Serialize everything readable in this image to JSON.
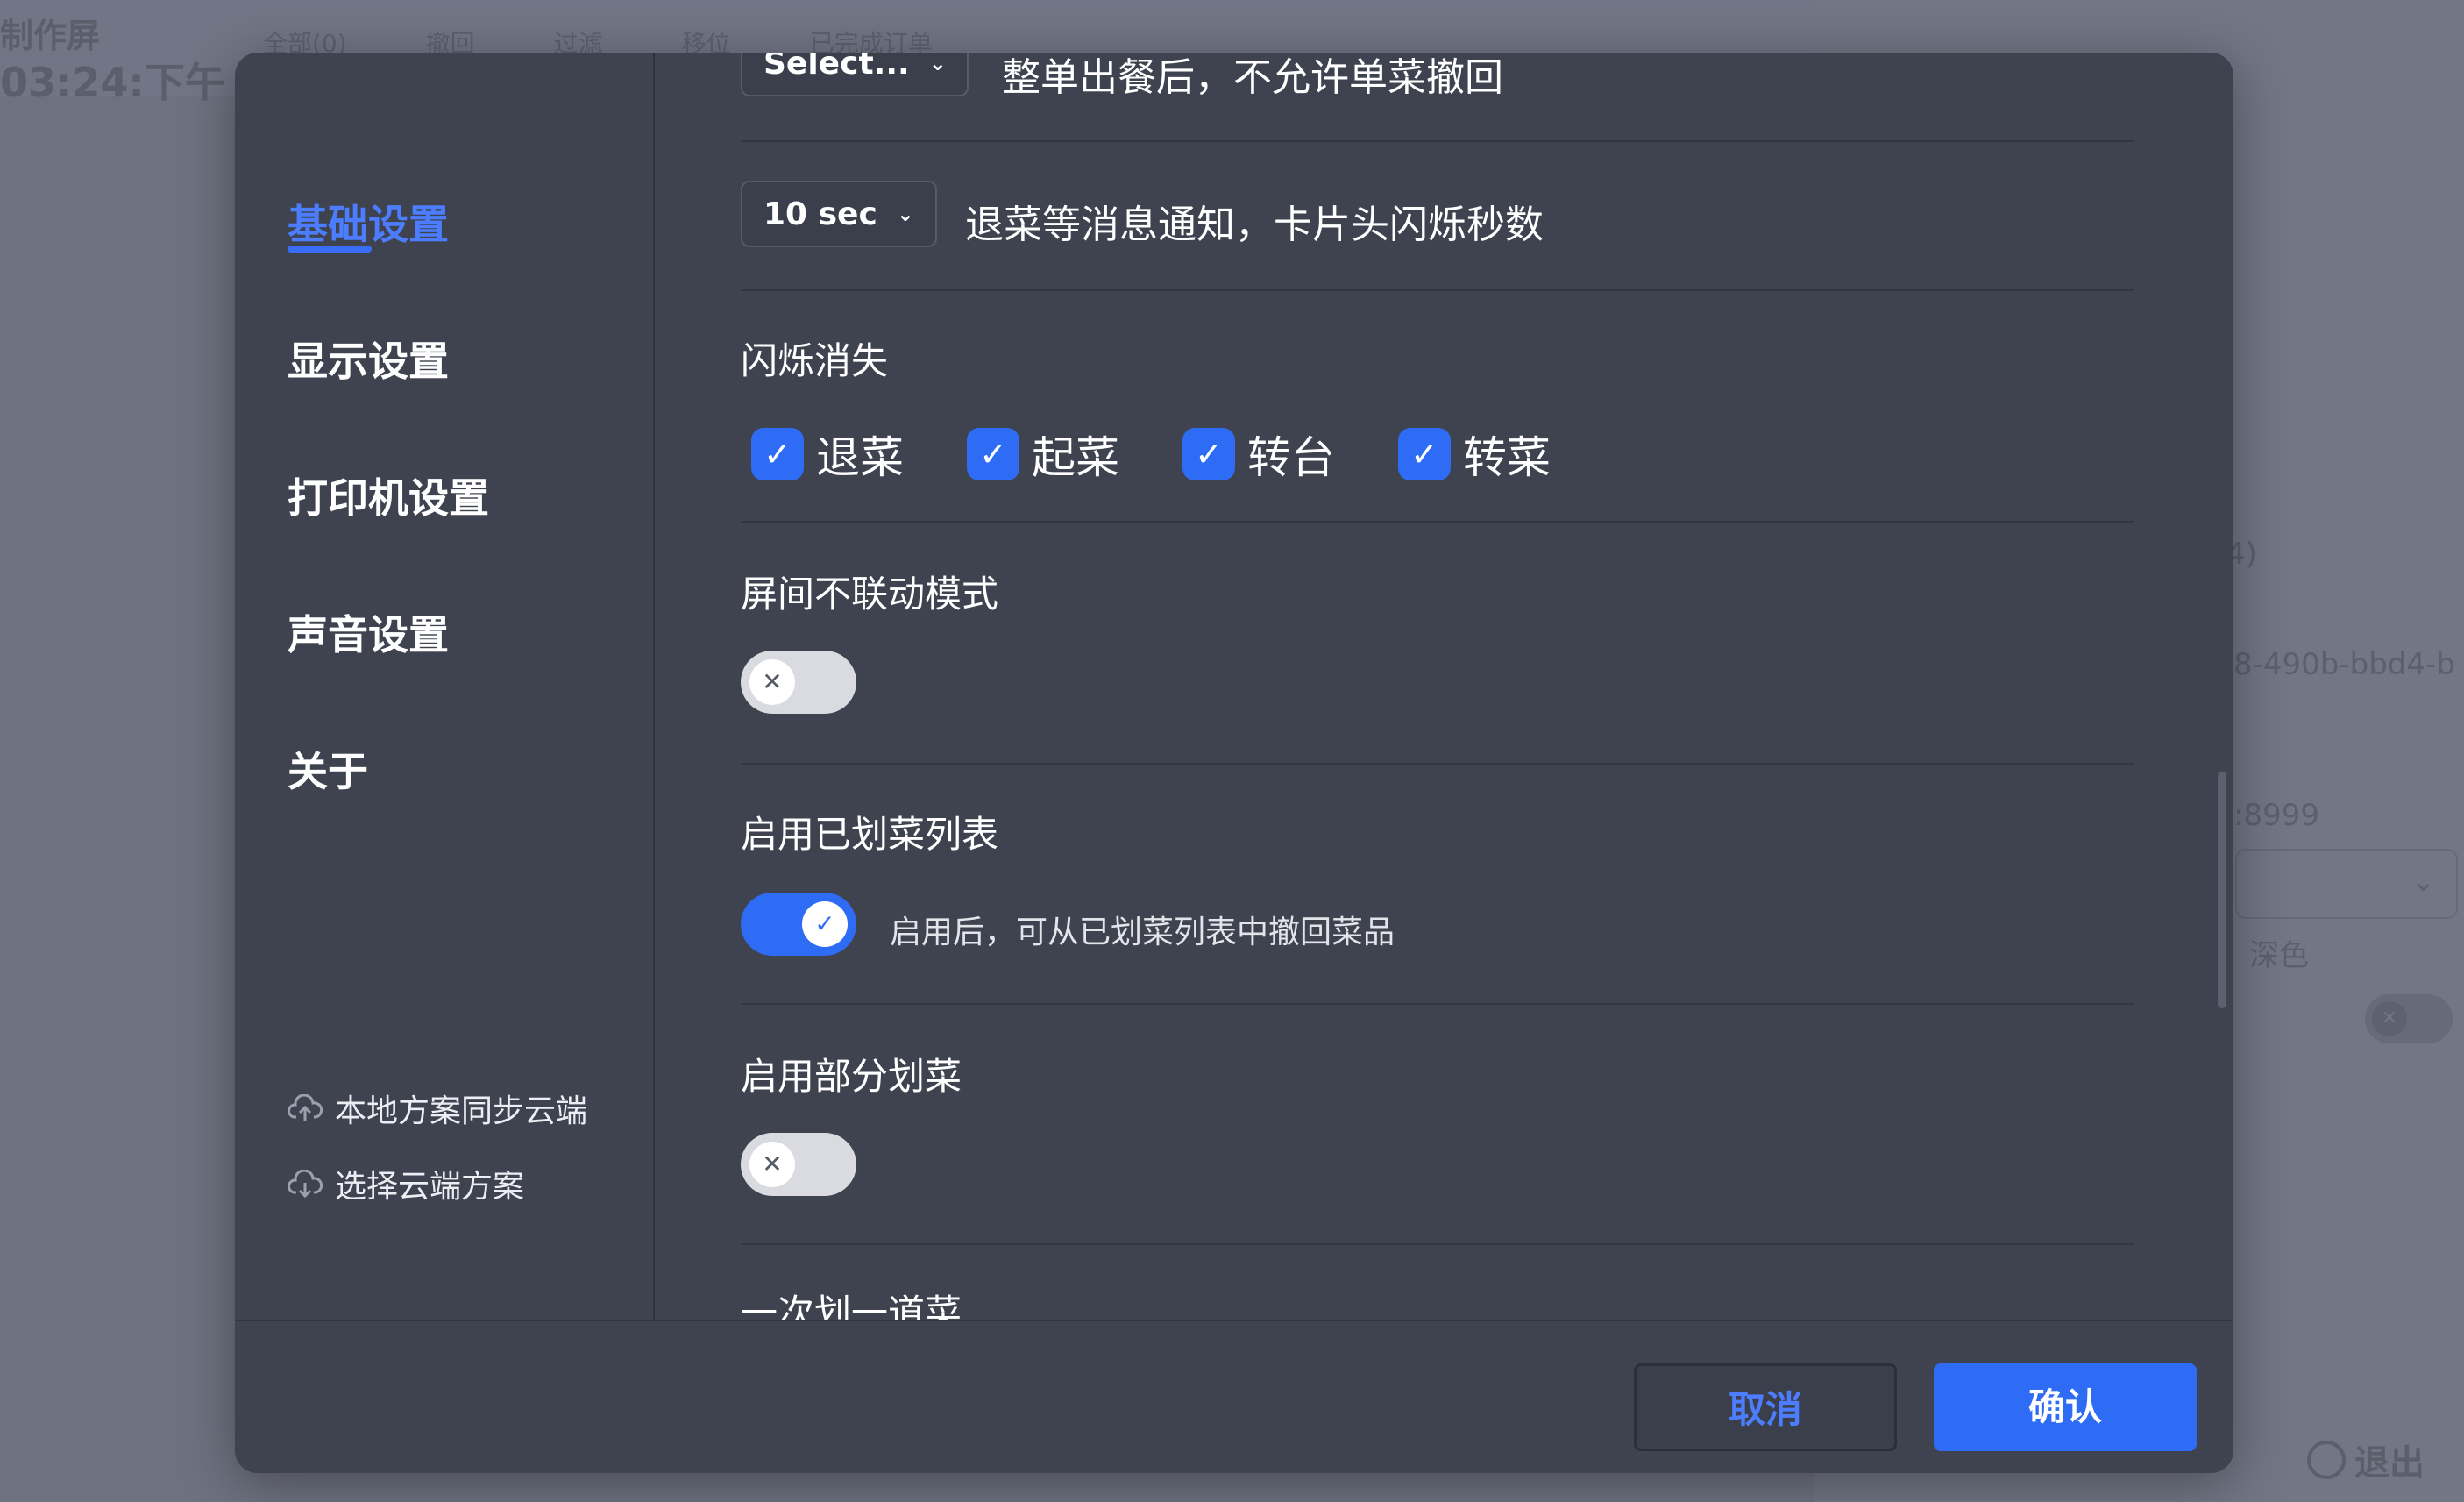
{
  "background": {
    "title": "制作屏",
    "time": "03:24:下午",
    "toolbar": [
      "全部(0)",
      "撤回",
      "过滤",
      "移位",
      "已完成订单"
    ],
    "right_texts": [
      "4)",
      "8-490b-bbd4-b",
      ":8999",
      "深色"
    ],
    "exit_label": "退出"
  },
  "sidebar": {
    "items": [
      {
        "label": "基础设置",
        "active": true
      },
      {
        "label": "显示设置",
        "active": false
      },
      {
        "label": "打印机设置",
        "active": false
      },
      {
        "label": "声音设置",
        "active": false
      },
      {
        "label": "关于",
        "active": false
      }
    ],
    "cloud_sync": "本地方案同步云端",
    "cloud_select": "选择云端方案"
  },
  "settings": {
    "row1": {
      "select_value": "Select...",
      "description": "整单出餐后，不允许单菜撤回"
    },
    "row2": {
      "select_value": "10 sec",
      "description": "退菜等消息通知，卡片头闪烁秒数"
    },
    "flash": {
      "title": "闪烁消失",
      "options": [
        {
          "label": "退菜",
          "checked": true
        },
        {
          "label": "起菜",
          "checked": true
        },
        {
          "label": "转台",
          "checked": true
        },
        {
          "label": "转菜",
          "checked": true
        }
      ]
    },
    "independent_mode": {
      "title": "屏间不联动模式",
      "enabled": false
    },
    "crossed_list": {
      "title": "启用已划菜列表",
      "enabled": true,
      "hint": "启用后，可从已划菜列表中撤回菜品"
    },
    "partial_cross": {
      "title": "启用部分划菜",
      "enabled": false
    },
    "one_at_a_time": {
      "title": "一次划一道菜"
    }
  },
  "footer": {
    "cancel_label": "取消",
    "confirm_label": "确认"
  },
  "colors": {
    "accent": "#2f6cf5",
    "modal_bg": "#3f4350",
    "overlay": "#6e7280"
  }
}
